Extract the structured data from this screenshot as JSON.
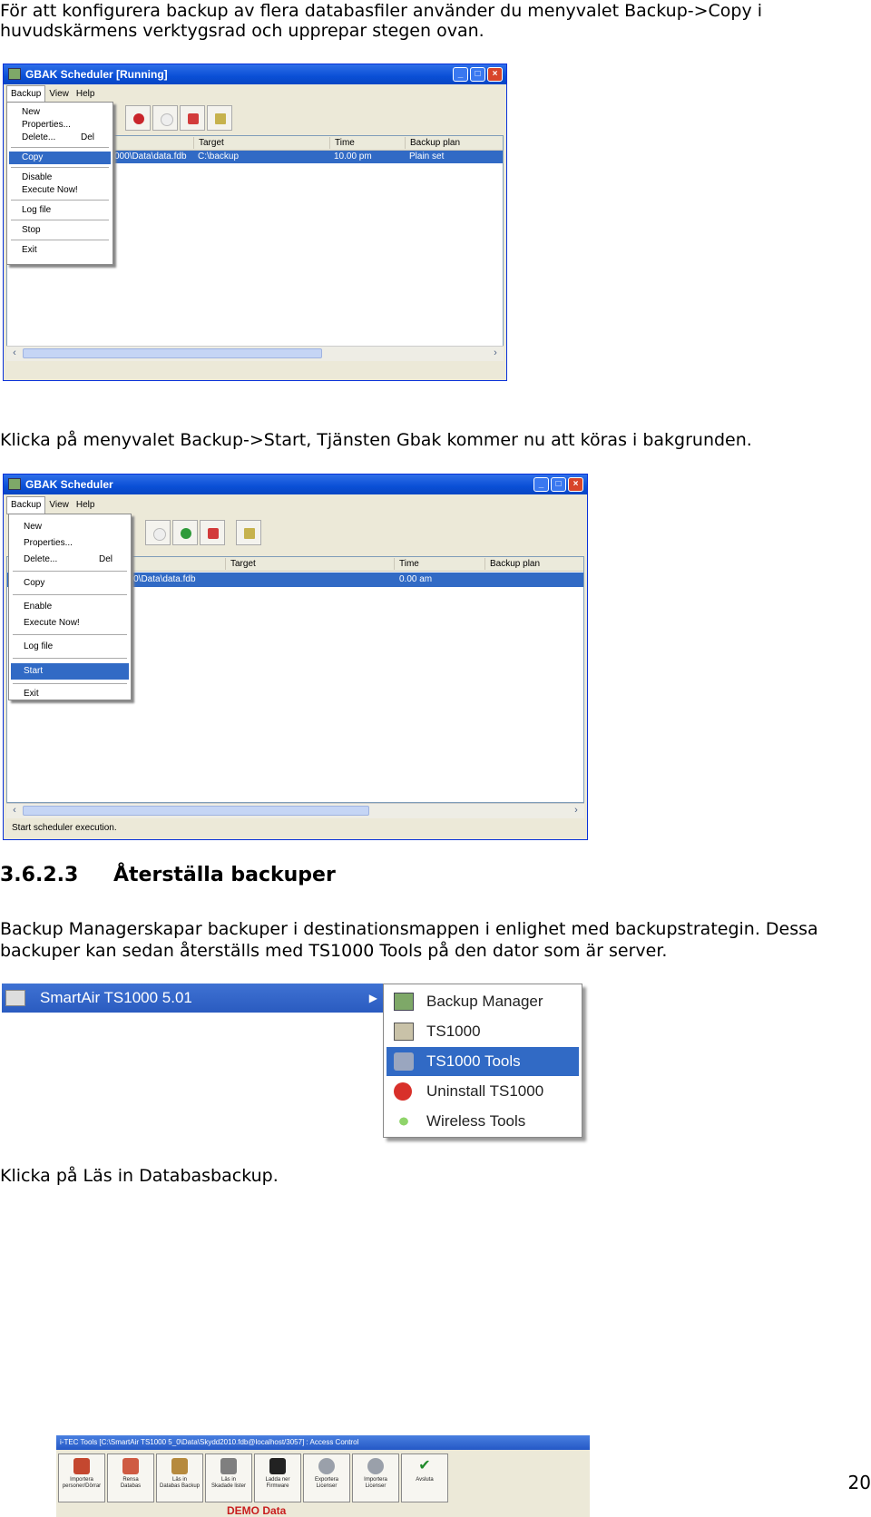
{
  "paragraphs": {
    "p1_line1": "För att konfigurera backup av flera databasfiler använder du menyvalet Backup->Copy i",
    "p1_line2": "huvudskärmens verktygsrad och upprepar stegen ovan.",
    "p2": "Klicka på menyvalet Backup->Start, Tjänsten Gbak kommer nu att köras i bakgrunden.",
    "p3_line1": "Backup Managerskapar backuper i destinationsmappen i enlighet med backupstrategin. Dessa",
    "p3_line2": "backuper kan sedan återställs med TS1000 Tools på den dator som är server.",
    "p4": "Klicka på Läs in Databasbackup."
  },
  "section": {
    "number": "3.6.2.3",
    "title": "Återställa backuper"
  },
  "page_number": "20",
  "window1": {
    "title": "GBAK Scheduler [Running]",
    "menu": [
      "Backup",
      "View",
      "Help"
    ],
    "columns": [
      "Target",
      "Time",
      "Backup plan"
    ],
    "row": {
      "file": "000\\Data\\data.fdb",
      "target": "C:\\backup",
      "time": "10.00 pm",
      "plan": "Plain set"
    },
    "dropdown": {
      "new": "New",
      "properties": "Properties...",
      "delete": "Delete...",
      "delete_shortcut": "Del",
      "copy": "Copy",
      "disable": "Disable",
      "execute": "Execute Now!",
      "log": "Log file",
      "stop": "Stop",
      "exit": "Exit"
    }
  },
  "window2": {
    "title": "GBAK Scheduler",
    "menu": [
      "Backup",
      "View",
      "Help"
    ],
    "columns": [
      "Target",
      "Time",
      "Backup plan"
    ],
    "row": {
      "file": "000\\Data\\data.fdb",
      "time": "0.00 am"
    },
    "status": "Start scheduler execution.",
    "dropdown": {
      "new": "New",
      "properties": "Properties...",
      "delete": "Delete...",
      "delete_shortcut": "Del",
      "copy": "Copy",
      "enable": "Enable",
      "execute": "Execute Now!",
      "log": "Log file",
      "start": "Start",
      "exit": "Exit"
    }
  },
  "startmenu": {
    "program": "SmartAir TS1000 5.01",
    "items": [
      "Backup Manager",
      "TS1000",
      "TS1000 Tools",
      "Uninstall TS1000",
      "Wireless Tools"
    ]
  },
  "toolsbar": {
    "title": "i-TEC Tools [C:\\SmartAir TS1000 5_0\\Data\\Skydd2010.fdb@localhost/3057] : Access Control",
    "buttons": [
      "Importera\npersoner/Dörrar",
      "Rensa\nDatabas",
      "Läs in\nDatabas Backup",
      "Läs in\nSkadade lister",
      "Ladda ner\nFirmware",
      "Exportera Licenser",
      "Importera Licenser",
      "Avsluta"
    ],
    "demo": "DEMO Data"
  },
  "colors": {
    "xp_blue": "#0a4fd6",
    "selection": "#316ac5",
    "demo_red": "#c81e1e"
  }
}
